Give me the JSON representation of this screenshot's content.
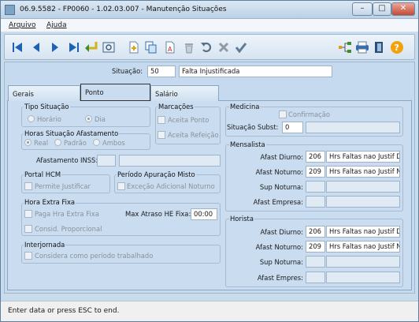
{
  "window": {
    "title": "06.9.5582 - FP0060 - 1.02.03.007 - Manutenção Situações",
    "min": "–",
    "max": "□",
    "close": "✕"
  },
  "menu": {
    "arquivo": "Arquivo",
    "ajuda": "Ajuda"
  },
  "situacao": {
    "label": "Situação:",
    "code": "50",
    "desc": "Falta Injustificada"
  },
  "tabs": {
    "gerais": "Gerais",
    "ponto": "Ponto",
    "salario": "Salário"
  },
  "tipo": {
    "title": "Tipo Situação",
    "horario": "Horário",
    "dia": "Dia"
  },
  "marcacoes": {
    "title": "Marcações",
    "aceita_ponto": "Aceita Ponto",
    "aceita_refeicao": "Aceita Refeição"
  },
  "horas": {
    "title": "Horas Situação Afastamento",
    "real": "Real",
    "padrao": "Padrão",
    "ambos": "Ambos"
  },
  "afastamento": {
    "label": "Afastamento INSS:"
  },
  "portal": {
    "title": "Portal HCM",
    "permite": "Permite Justificar"
  },
  "periodo": {
    "title": "Período Apuração Misto",
    "excecao": "Exceção Adicional Noturno"
  },
  "hora_extra": {
    "title": "Hora Extra Fixa",
    "paga": "Paga Hra Extra Fixa",
    "max_label": "Max Atraso HE Fixa:",
    "max_value": "00:00",
    "consid": "Consid. Proporcional"
  },
  "interjornada": {
    "title": "Interjornada",
    "considera": "Considera como período trabalhado"
  },
  "medicina": {
    "title": "Medicina",
    "confirmacao": "Confirmação",
    "subst_label": "Situação Subst:",
    "subst_value": "0"
  },
  "mensalista": {
    "title": "Mensalista",
    "diurno_label": "Afast Diurno:",
    "diurno_code": "206",
    "diurno_desc": "Hrs Faltas nao Justif D",
    "noturno_label": "Afast Noturno:",
    "noturno_code": "209",
    "noturno_desc": "Hrs Faltas nao Justif N",
    "sup_label": "Sup Noturna:",
    "empresa_label": "Afast Empresa:"
  },
  "horista": {
    "title": "Horista",
    "diurno_label": "Afast Diurno:",
    "diurno_code": "206",
    "diurno_desc": "Hrs Faltas nao Justif D",
    "noturno_label": "Afast Noturno:",
    "noturno_code": "209",
    "noturno_desc": "Hrs Faltas nao Justif N",
    "sup_label": "Sup Noturna:",
    "empresa_label": "Afast Empres:"
  },
  "status": {
    "text": "Enter data or press ESC to end."
  },
  "colors": {
    "accent": "#1e6fc0",
    "panel": "#c9dcf0"
  }
}
